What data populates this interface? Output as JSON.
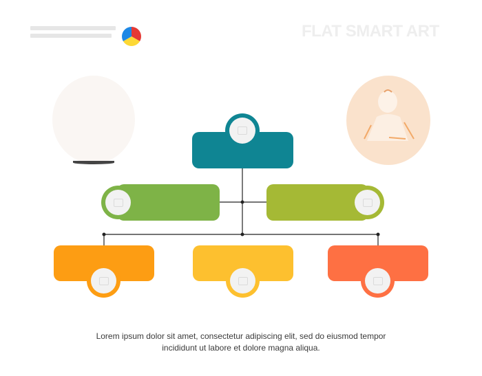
{
  "header": {
    "title": "FLAT SMART ART"
  },
  "nodes": {
    "top": {
      "color": "#0f8593"
    },
    "level2_left": {
      "color": "#7eb347"
    },
    "level2_right": {
      "color": "#a5b935"
    },
    "level3_left": {
      "color": "#fd9d13"
    },
    "level3_middle": {
      "color": "#fdc02f"
    },
    "level3_right": {
      "color": "#fe7043"
    }
  },
  "caption": {
    "line1": "Lorem ipsum dolor sit amet, consectetur adipiscing elit, sed do eiusmod tempor",
    "line2": "incididunt ut labore et dolore magna aliqua."
  },
  "colors": {
    "brand_pie": [
      "#e53935",
      "#1e88e5",
      "#fdd835"
    ],
    "connector": "#222222"
  }
}
